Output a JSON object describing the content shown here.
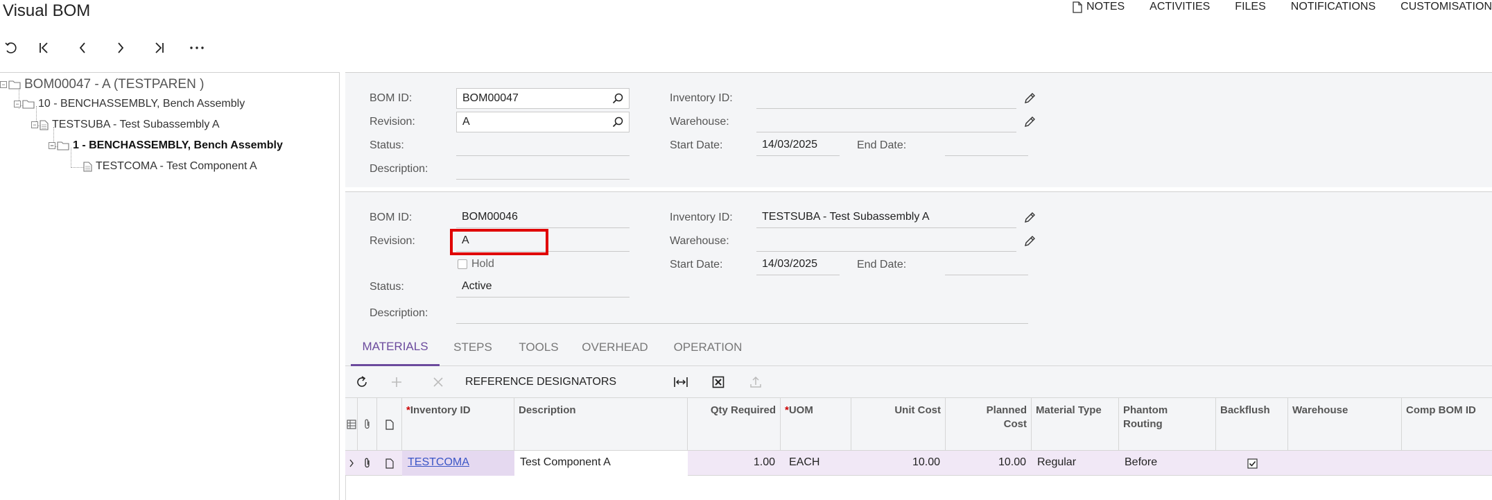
{
  "page": {
    "title": "Visual BOM"
  },
  "top_links": [
    "NOTES",
    "ACTIVITIES",
    "FILES",
    "NOTIFICATIONS",
    "CUSTOMISATION"
  ],
  "toolbar": [
    "undo-icon",
    "first-record-icon",
    "previous-record-icon",
    "next-record-icon",
    "last-record-icon",
    "more-icon"
  ],
  "tree": {
    "nodes": [
      {
        "label": "BOM00047 - A (TESTPAREN )",
        "icon": "folder-icon"
      },
      {
        "label": "10 - BENCHASSEMBLY, Bench Assembly",
        "icon": "folder-icon"
      },
      {
        "label": "TESTSUBA - Test Subassembly A",
        "icon": "document-icon"
      },
      {
        "label": "1 - BENCHASSEMBLY, Bench Assembly",
        "icon": "folder-icon"
      },
      {
        "label": "TESTCOMA - Test Component A",
        "icon": "document-icon"
      }
    ]
  },
  "form1": {
    "bom_id_label": "BOM ID:",
    "bom_id": "BOM00047",
    "revision_label": "Revision:",
    "revision": "A",
    "status_label": "Status:",
    "status": "",
    "description_label": "Description:",
    "description": "",
    "inventory_id_label": "Inventory ID:",
    "inventory_id": "",
    "warehouse_label": "Warehouse:",
    "warehouse": "",
    "start_date_label": "Start Date:",
    "start_date": "14/03/2025",
    "end_date_label": "End Date:",
    "end_date": ""
  },
  "form2": {
    "bom_id_label": "BOM ID:",
    "bom_id": "BOM00046",
    "revision_label": "Revision:",
    "revision": "A",
    "hold_label": "Hold",
    "hold": false,
    "status_label": "Status:",
    "status": "Active",
    "description_label": "Description:",
    "description": "",
    "inventory_id_label": "Inventory ID:",
    "inventory_id": "TESTSUBA - Test Subassembly A",
    "warehouse_label": "Warehouse:",
    "warehouse": "",
    "start_date_label": "Start Date:",
    "start_date": "14/03/2025",
    "end_date_label": "End Date:",
    "end_date": ""
  },
  "tabs": [
    "MATERIALS",
    "STEPS",
    "TOOLS",
    "OVERHEAD",
    "OPERATION"
  ],
  "active_tab": "MATERIALS",
  "grid_toolbar": {
    "reference_designators": "REFERENCE DESIGNATORS"
  },
  "grid": {
    "columns": {
      "inventory_id": "Inventory ID",
      "description": "Description",
      "qty_required": "Qty Required",
      "uom": "UOM",
      "unit_cost": "Unit Cost",
      "planned_cost_1": "Planned",
      "planned_cost_2": "Cost",
      "material_type": "Material Type",
      "phantom_routing_1": "Phantom",
      "phantom_routing_2": "Routing",
      "backflush": "Backflush",
      "warehouse": "Warehouse",
      "comp_bom_id": "Comp BOM ID"
    },
    "required_marker": "*",
    "rows": [
      {
        "inventory_id": "TESTCOMA",
        "description": "Test Component A",
        "qty_required": "1.00",
        "uom": "EACH",
        "unit_cost": "10.00",
        "planned_cost": "10.00",
        "material_type": "Regular",
        "phantom_routing": "Before",
        "backflush": true,
        "warehouse": "",
        "comp_bom_id": ""
      }
    ]
  }
}
